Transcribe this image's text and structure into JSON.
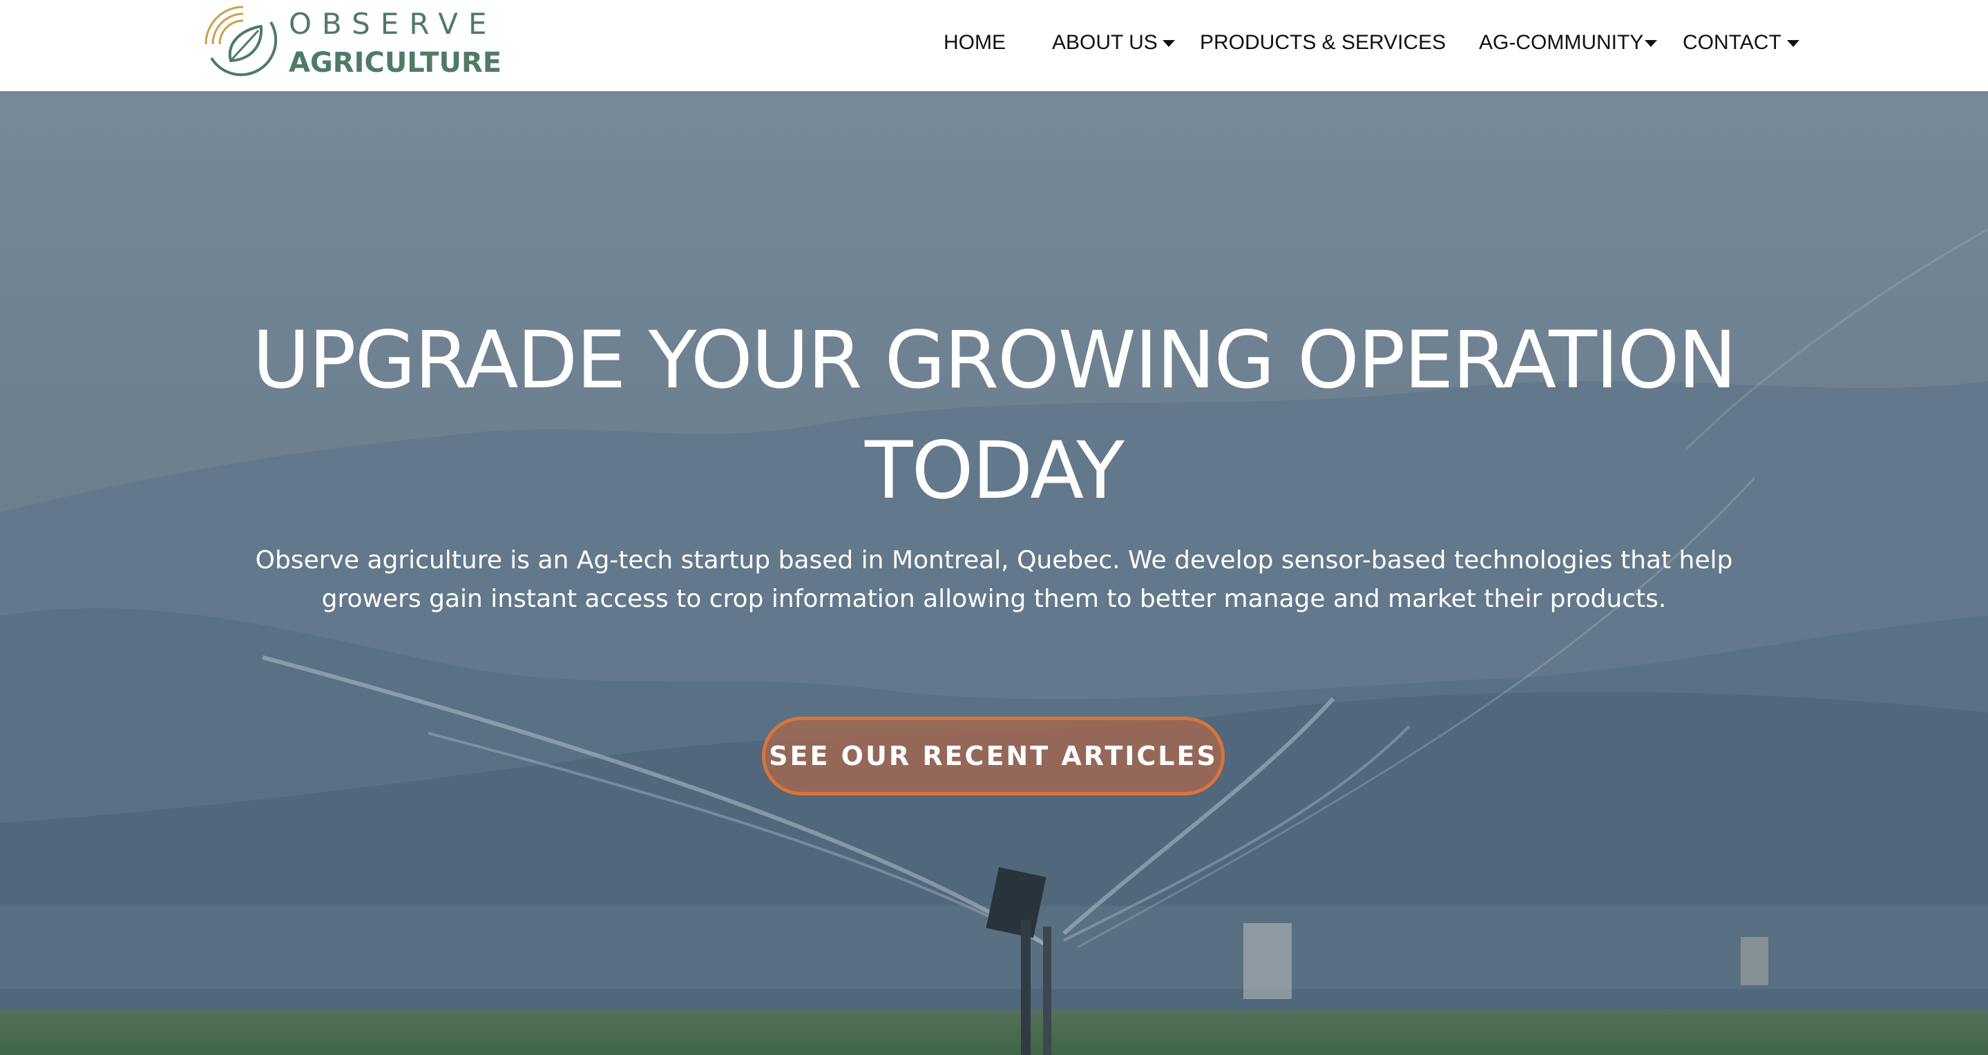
{
  "brand": {
    "line1": "OBSERVE",
    "line2": "AGRICULTURE",
    "logo_icon": "leaf-signal-icon",
    "colors": {
      "green": "#4f7a66",
      "gold": "#c9a14a"
    }
  },
  "nav": {
    "items": [
      {
        "label": "HOME",
        "has_dropdown": false
      },
      {
        "label": "ABOUT US",
        "has_dropdown": true
      },
      {
        "label": "PRODUCTS & SERVICES",
        "has_dropdown": false
      },
      {
        "label": "AG-COMMUNITY",
        "has_dropdown": true
      },
      {
        "label": "CONTACT",
        "has_dropdown": true
      }
    ],
    "dropdown_icon": "caret-down-icon"
  },
  "hero": {
    "title": "UPGRADE YOUR GROWING OPERATION TODAY",
    "description": "Observe agriculture is an Ag-tech startup based in Montreal, Quebec. We develop sensor-based technologies that help growers gain instant access to crop information allowing them to better manage and market their products.",
    "cta_label": "SEE OUR RECENT ARTICLES",
    "cta_border_color": "#d9743a"
  }
}
